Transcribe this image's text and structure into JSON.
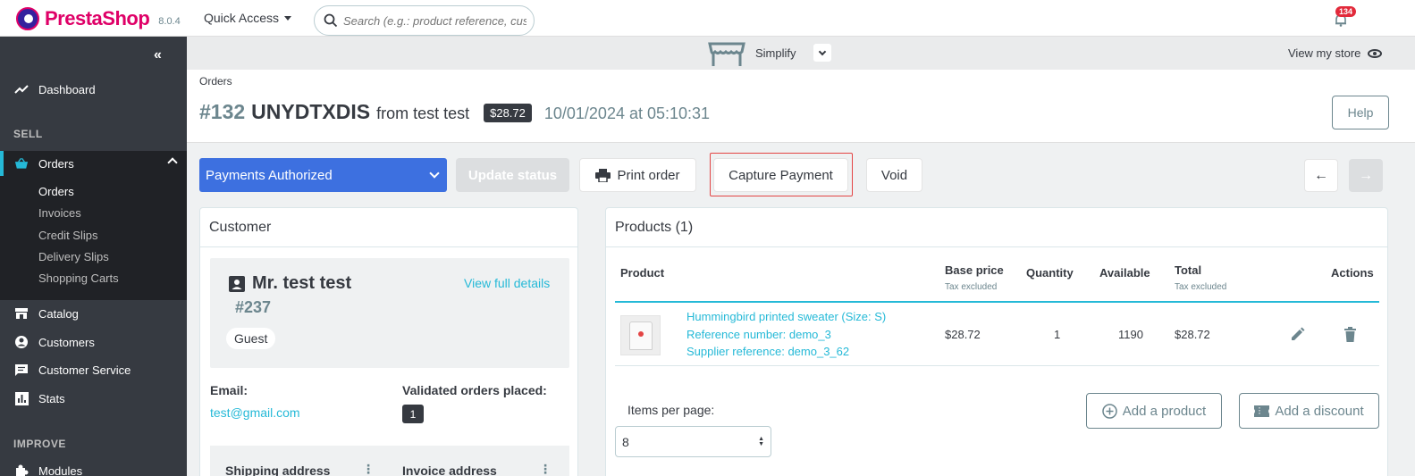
{
  "header": {
    "brand": "PrestaShop",
    "version": "8.0.4",
    "quick_access": "Quick Access",
    "search_placeholder": "Search (e.g.: product reference, custon",
    "notifications_count": "134"
  },
  "sidebar": {
    "dashboard": "Dashboard",
    "sell_section": "SELL",
    "orders": "Orders",
    "orders_sub": [
      "Orders",
      "Invoices",
      "Credit Slips",
      "Delivery Slips",
      "Shopping Carts"
    ],
    "catalog": "Catalog",
    "customers": "Customers",
    "customer_service": "Customer Service",
    "stats": "Stats",
    "improve_section": "IMPROVE",
    "modules": "Modules"
  },
  "modebar": {
    "mode": "Simplify",
    "view_store": "View my store"
  },
  "page": {
    "breadcrumb": "Orders",
    "order_number": "#132",
    "order_reference": "UNYDTXDIS",
    "from_text": "from test test",
    "total": "$28.72",
    "date": "10/01/2024 at 05:10:31",
    "help": "Help"
  },
  "actions": {
    "status": "Payments Authorized",
    "update_status": "Update status",
    "print_order": "Print order",
    "capture_payment": "Capture Payment",
    "void": "Void"
  },
  "customer": {
    "heading": "Customer",
    "name": "Mr. test test",
    "id": "#237",
    "type": "Guest",
    "view_full": "View full details",
    "email_label": "Email:",
    "email": "test@gmail.com",
    "validated_label": "Validated orders placed:",
    "validated_count": "1",
    "shipping_label": "Shipping address",
    "invoice_label": "Invoice address"
  },
  "products": {
    "heading": "Products (1)",
    "columns": {
      "product": "Product",
      "base_price": "Base price",
      "tax_excluded": "Tax excluded",
      "quantity": "Quantity",
      "available": "Available",
      "total": "Total",
      "actions": "Actions"
    },
    "rows": [
      {
        "name": "Hummingbird printed sweater (Size: S)",
        "reference": "Reference number: demo_3",
        "supplier": "Supplier reference: demo_3_62",
        "base_price": "$28.72",
        "quantity": "1",
        "available": "1190",
        "total": "$28.72"
      }
    ],
    "items_per_page_label": "Items per page:",
    "items_per_page": "8",
    "add_product": "Add a product",
    "add_discount": "Add a discount"
  },
  "colors": {
    "accent": "#25b9d7",
    "status_blue": "#3d70e0",
    "brand_pink": "#df0067",
    "sidebar_bg": "#363a41",
    "highlight_red": "#e34444"
  }
}
